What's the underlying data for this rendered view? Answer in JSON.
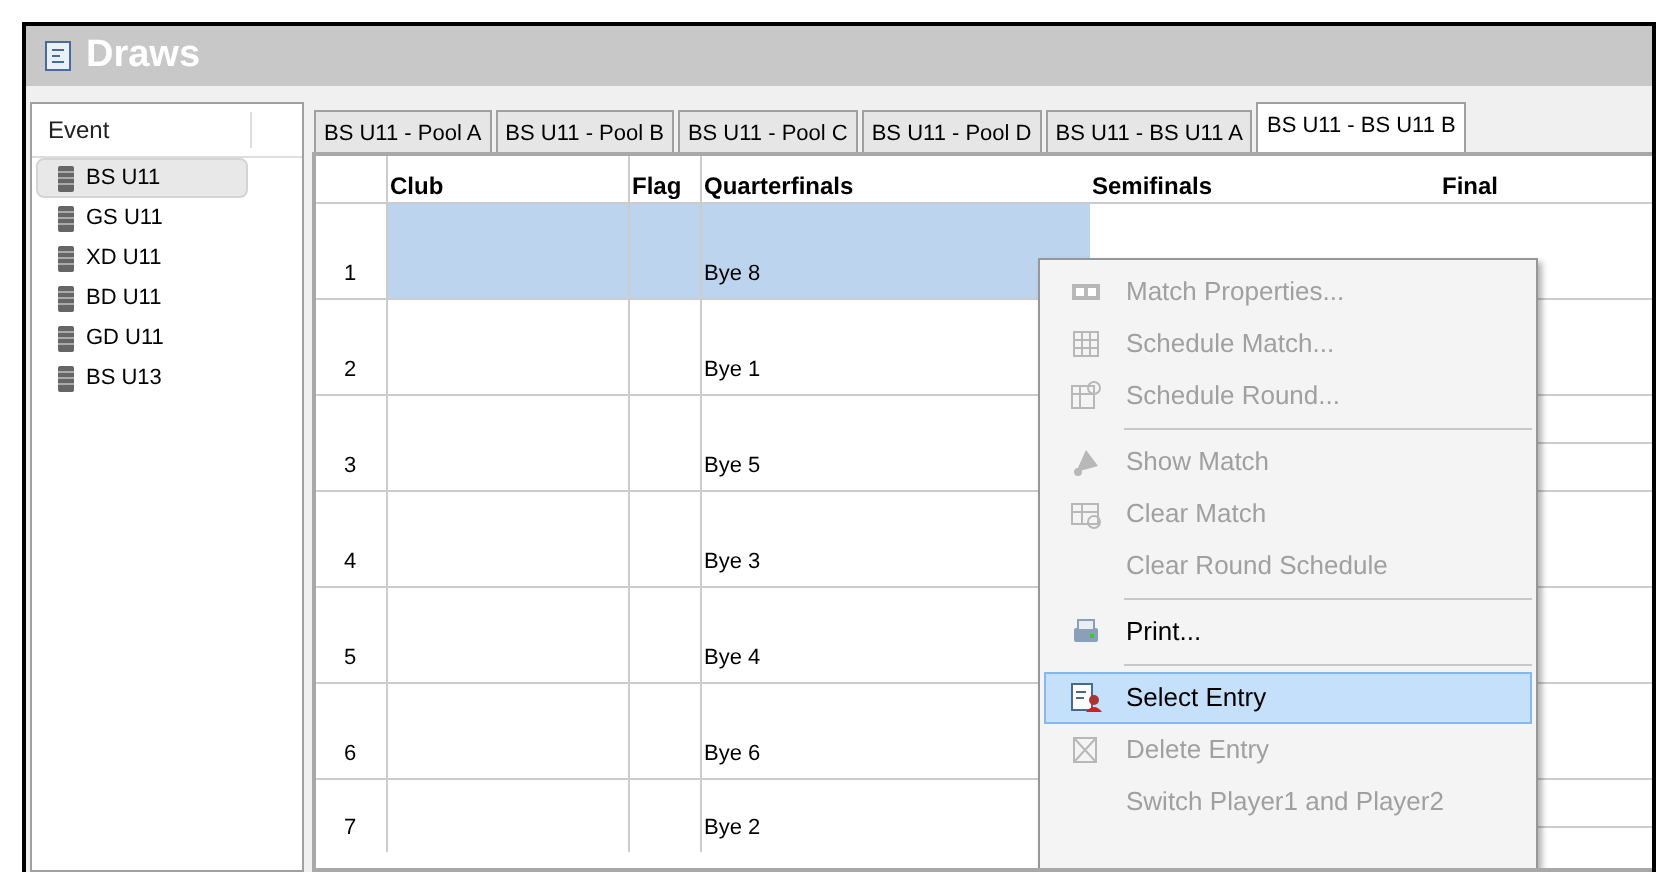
{
  "window": {
    "title": "Draws"
  },
  "sidebar": {
    "header": "Event",
    "items": [
      {
        "label": "BS U11",
        "selected": true
      },
      {
        "label": "GS U11",
        "selected": false
      },
      {
        "label": "XD U11",
        "selected": false
      },
      {
        "label": "BD U11",
        "selected": false
      },
      {
        "label": "GD U11",
        "selected": false
      },
      {
        "label": "BS U13",
        "selected": false
      }
    ]
  },
  "tabs": [
    {
      "label": "BS U11 - Pool A",
      "selected": false
    },
    {
      "label": "BS U11 - Pool B",
      "selected": false
    },
    {
      "label": "BS U11 - Pool C",
      "selected": false
    },
    {
      "label": "BS U11 - Pool D",
      "selected": false
    },
    {
      "label": "BS U11 - BS U11 A",
      "selected": false
    },
    {
      "label": "BS U11 - BS U11 B",
      "selected": true
    }
  ],
  "table": {
    "columns": [
      "Club",
      "Flag",
      "Quarterfinals",
      "Semifinals",
      "Final"
    ],
    "rows": [
      {
        "number": "1",
        "quarterfinal": "Bye 8",
        "selected": true
      },
      {
        "number": "2",
        "quarterfinal": "Bye 1",
        "selected": false
      },
      {
        "number": "3",
        "quarterfinal": "Bye 5",
        "selected": false
      },
      {
        "number": "4",
        "quarterfinal": "Bye 3",
        "selected": false
      },
      {
        "number": "5",
        "quarterfinal": "Bye 4",
        "selected": false
      },
      {
        "number": "6",
        "quarterfinal": "Bye 6",
        "selected": false
      },
      {
        "number": "7",
        "quarterfinal": "Bye 2",
        "selected": false
      }
    ]
  },
  "context_menu": [
    {
      "kind": "item",
      "label": "Match Properties...",
      "disabled": true,
      "selected": false
    },
    {
      "kind": "item",
      "label": "Schedule Match...",
      "disabled": true,
      "selected": false
    },
    {
      "kind": "item",
      "label": "Schedule Round...",
      "disabled": true,
      "selected": false
    },
    {
      "kind": "separator"
    },
    {
      "kind": "item",
      "label": "Show Match",
      "disabled": true,
      "selected": false
    },
    {
      "kind": "item",
      "label": "Clear Match",
      "disabled": true,
      "selected": false
    },
    {
      "kind": "item",
      "label": "Clear Round Schedule",
      "disabled": true,
      "selected": false
    },
    {
      "kind": "separator"
    },
    {
      "kind": "item",
      "label": "Print...",
      "disabled": false,
      "selected": false
    },
    {
      "kind": "separator"
    },
    {
      "kind": "item",
      "label": "Select Entry",
      "disabled": false,
      "selected": true
    },
    {
      "kind": "item",
      "label": "Delete Entry",
      "disabled": true,
      "selected": false
    },
    {
      "kind": "item",
      "label": "Switch Player1 and Player2",
      "disabled": true,
      "selected": false
    }
  ]
}
